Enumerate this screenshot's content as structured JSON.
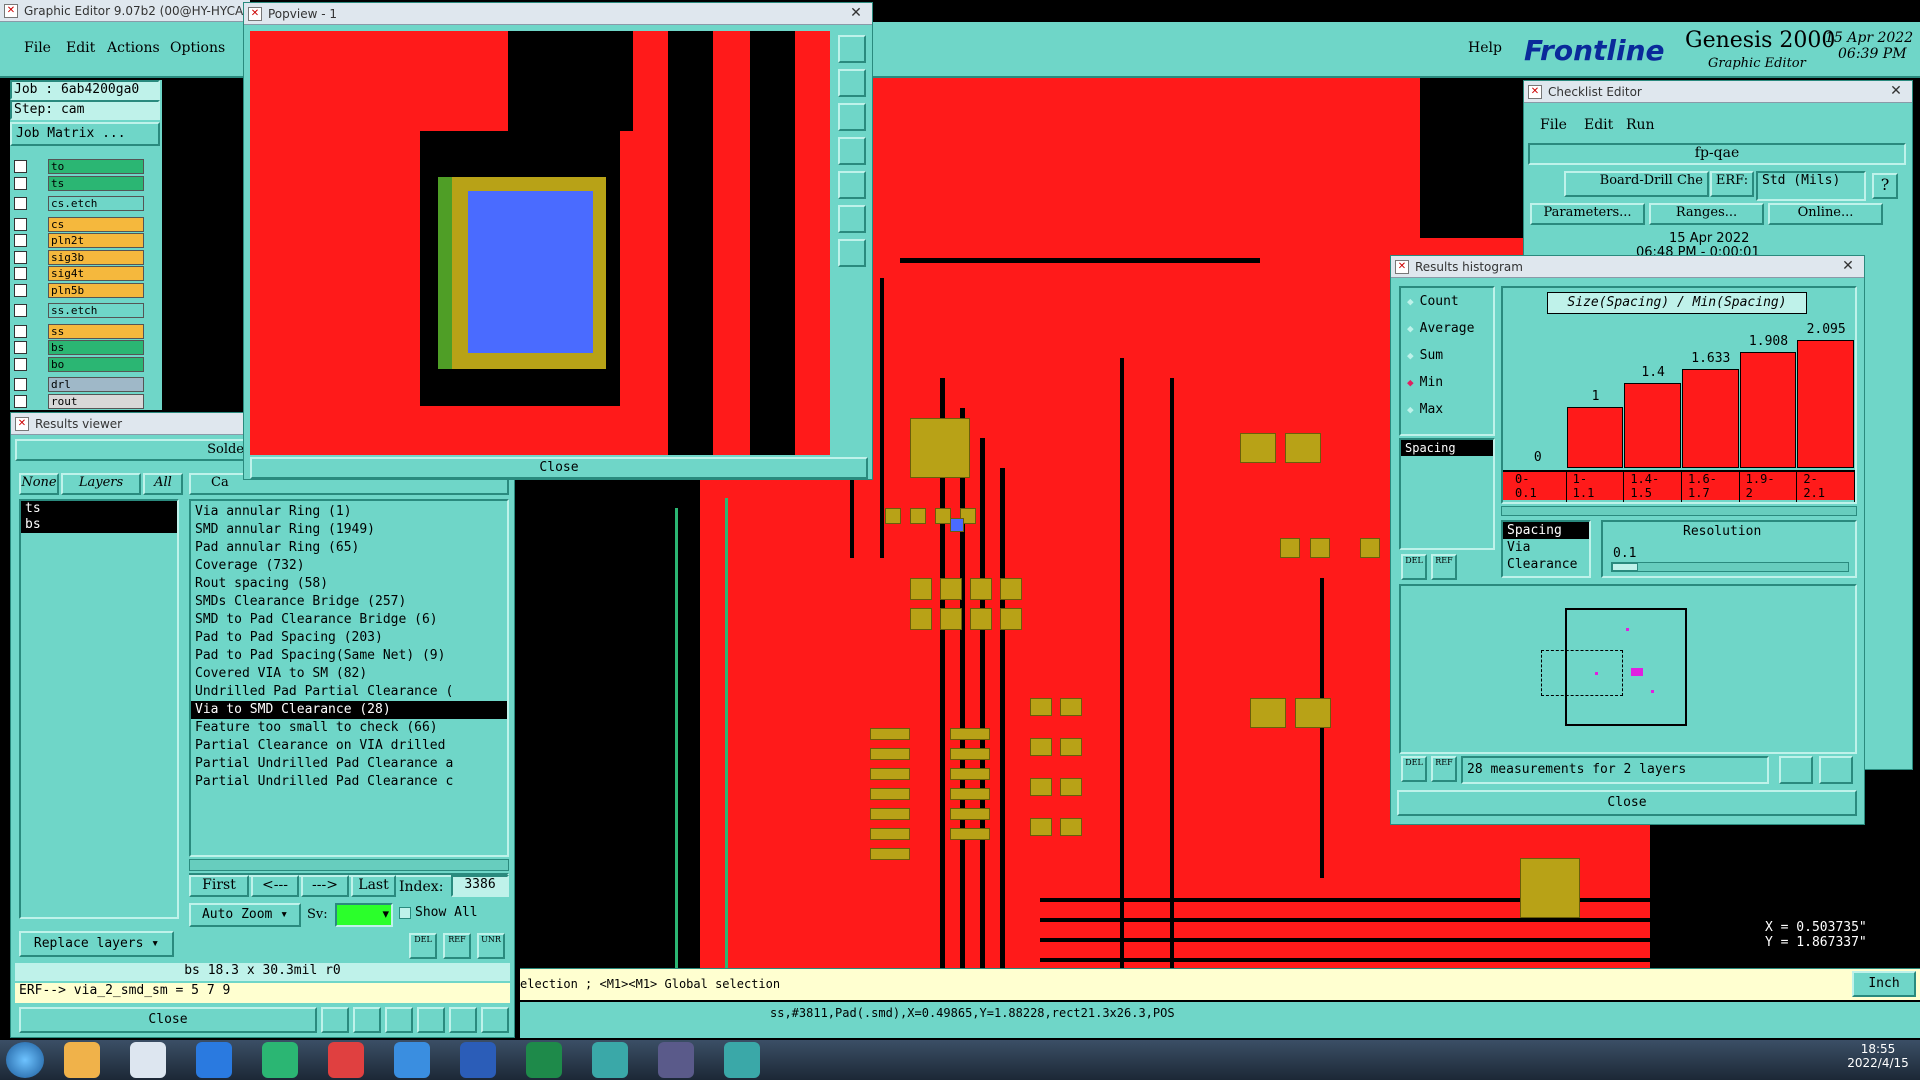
{
  "app": {
    "title": "Graphic Editor 9.07b2 (00@HY-HYCA",
    "menu": [
      "File",
      "Edit",
      "Actions",
      "Options"
    ],
    "help": "Help",
    "brand": "Frontline",
    "product": "Genesis 2000",
    "product_sub": "Graphic Editor",
    "date": "15 Apr 2022",
    "time": "06:39 PM"
  },
  "job": {
    "job": "Job : 6ab4200ga0",
    "step": "Step: cam",
    "matrix": "Job Matrix ..."
  },
  "layers": [
    {
      "name": "to",
      "color": "#2bb673"
    },
    {
      "name": "ts",
      "color": "#2bb673"
    },
    {
      "name": "cs.etch",
      "color": "#6fd6c8"
    },
    {
      "name": "cs",
      "color": "#f5b83d"
    },
    {
      "name": "pln2t",
      "color": "#f5b83d"
    },
    {
      "name": "sig3b",
      "color": "#f5b83d"
    },
    {
      "name": "sig4t",
      "color": "#f5b83d"
    },
    {
      "name": "pln5b",
      "color": "#f5b83d"
    },
    {
      "name": "ss.etch",
      "color": "#6fd6c8"
    },
    {
      "name": "ss",
      "color": "#f5b83d"
    },
    {
      "name": "bs",
      "color": "#2bb673"
    },
    {
      "name": "bo",
      "color": "#2bb673"
    },
    {
      "name": "drl",
      "color": "#9fb8c8"
    },
    {
      "name": "rout",
      "color": "#d8d8d8"
    }
  ],
  "results_viewer": {
    "title": "Results viewer",
    "tab_partial": "Solde",
    "filter_buttons": [
      "None",
      "Layers",
      "All"
    ],
    "layer_list": [
      "ts",
      "bs"
    ],
    "column_header_partial": "Ca",
    "items": [
      "Via annular Ring (1)",
      "SMD annular Ring (1949)",
      "Pad annular Ring (65)",
      "Coverage (732)",
      "Rout spacing (58)",
      "SMDs Clearance Bridge (257)",
      "SMD to Pad Clearance Bridge (6)",
      "Pad to Pad Spacing (203)",
      "Pad to Pad Spacing(Same Net) (9)",
      "Covered VIA to SM (82)",
      "Undrilled Pad Partial Clearance (",
      "Via to SMD Clearance (28)",
      "Feature too small to check (66)",
      "Partial Clearance on VIA drilled",
      "Partial Undrilled Pad Clearance a",
      "Partial Undrilled Pad Clearance c"
    ],
    "selected_index": 11,
    "nav": {
      "first": "First",
      "prev": "<---",
      "next": "--->",
      "last": "Last",
      "index_label": "Index:",
      "index_value": "3386"
    },
    "auto_zoom": "Auto Zoom",
    "sv_label": "Sv:",
    "show_all": "Show All",
    "replace_layers": "Replace layers",
    "status": "bs 18.3 x 30.3mil  r0",
    "erf": "ERF--> via_2_smd_sm = 5 7 9",
    "close": "Close",
    "mini_del": "DEL",
    "mini_ref": "REF",
    "mini_unr": "UNR"
  },
  "popview": {
    "title": "Popview - 1",
    "close": "Close"
  },
  "checklist": {
    "title": "Checklist Editor",
    "menu": [
      "File",
      "Edit",
      "Run"
    ],
    "name": "fp-qae",
    "board": "Board-Drill Che",
    "erf": "ERF:",
    "std": "Std (Mils)",
    "q": "?",
    "params": "Parameters...",
    "ranges": "Ranges...",
    "online": "Online...",
    "date": "15 Apr 2022",
    "time": "06:48 PM - 0:00:01"
  },
  "histogram": {
    "title": "Results histogram",
    "options": [
      "Count",
      "Average",
      "Sum",
      "Min",
      "Max"
    ],
    "selected_option": "Min",
    "measure_list": [
      "Spacing"
    ],
    "heading": "Size(Spacing) / Min(Spacing)",
    "filters": [
      "Spacing",
      "Via",
      "Clearance"
    ],
    "resolution_label": "Resolution",
    "resolution_value": "0.1",
    "measurements": "28 measurements for 2 layers",
    "close": "Close",
    "del": "DEL",
    "ref": "REF"
  },
  "chart_data": {
    "type": "bar",
    "title": "Size(Spacing) / Min(Spacing)",
    "categories": [
      "0-\n0.1",
      "1-\n1.1",
      "1.4-\n1.5",
      "1.6-\n1.7",
      "1.9-\n2",
      "2-\n2.1"
    ],
    "values": [
      0,
      1,
      1.4,
      1.633,
      1.908,
      2.095
    ],
    "value_labels": [
      "0",
      "1",
      "1.4",
      "1.633",
      "1.908",
      "2.095"
    ],
    "ylim": [
      0,
      2.3
    ],
    "grid": false
  },
  "coords": {
    "x": "X = 0.503735\"",
    "y": "Y = 1.867337\""
  },
  "units": "Inch",
  "status_bar": {
    "message": "election ; <M1><M1> Global selection",
    "info": "ss,#3811,Pad(.smd),X=0.49865,Y=1.88228,rect21.3x26.3,POS"
  },
  "taskbar": {
    "time": "18:55",
    "date": "2022/4/15"
  },
  "colors": {
    "copper": "#ff1a1a",
    "pad": "#b8a217",
    "panel": "#6fd6c8",
    "selection": "#4a6bff"
  }
}
